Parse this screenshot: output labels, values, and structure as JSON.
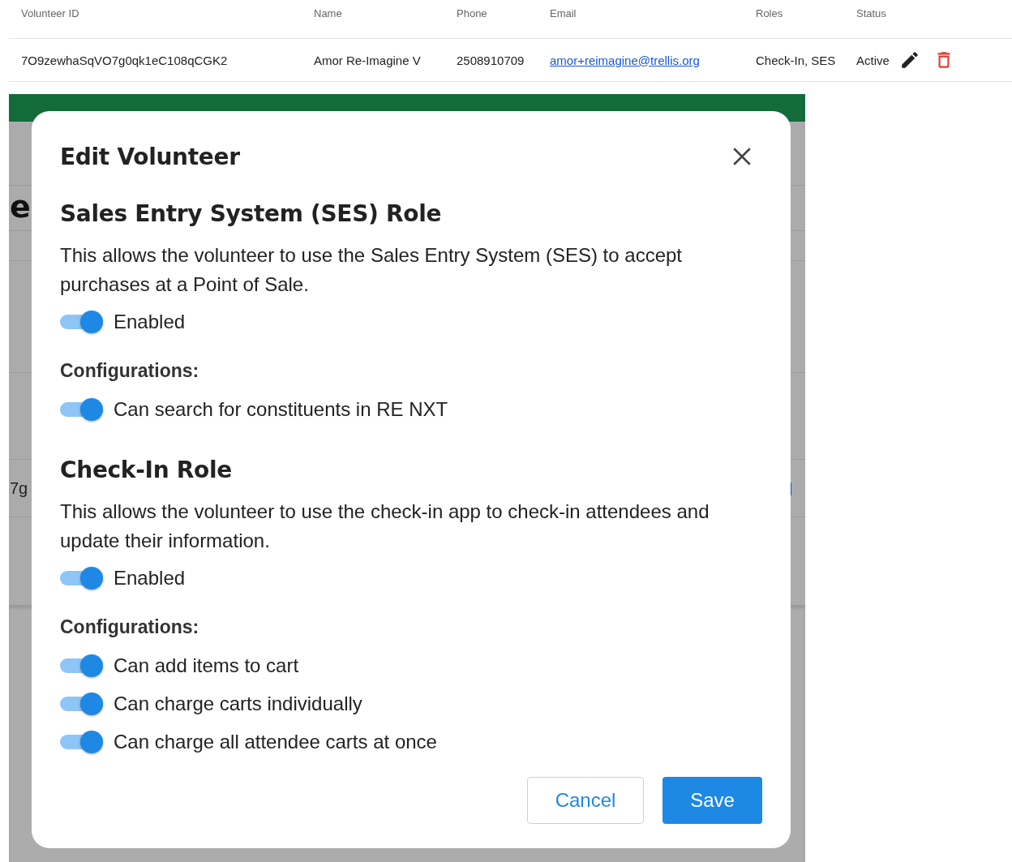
{
  "table": {
    "columns": [
      "Volunteer ID",
      "Name",
      "Phone",
      "Email",
      "Roles",
      "Status"
    ],
    "rows": [
      {
        "id": "7O9zewhaSqVO7g0qk1eC108qCGK2",
        "name": "Amor Re-Imagine V",
        "phone": "2508910709",
        "email": "amor+reimagine@trellis.org",
        "roles": "Check-In, SES",
        "status": "Active"
      }
    ]
  },
  "background": {
    "heading_fragment": "e",
    "cell_fragment": "7g"
  },
  "dialog": {
    "title": "Edit Volunteer",
    "sections": [
      {
        "title": "Sales Entry System (SES) Role",
        "description": "This allows the volunteer to use the Sales Entry System (SES) to accept purchases at a Point of Sale.",
        "toggle": {
          "label": "Enabled",
          "on": true
        },
        "config_title": "Configurations:",
        "configs": [
          {
            "label": "Can search for constituents in RE NXT",
            "on": true
          }
        ]
      },
      {
        "title": "Check-In Role",
        "description": "This allows the volunteer to use the check-in app to check-in attendees and update their information.",
        "toggle": {
          "label": "Enabled",
          "on": true
        },
        "config_title": "Configurations:",
        "configs": [
          {
            "label": "Can add items to cart",
            "on": true
          },
          {
            "label": "Can charge carts individually",
            "on": true
          },
          {
            "label": "Can charge all attendee carts at once",
            "on": true
          }
        ]
      }
    ],
    "buttons": [
      {
        "label": "Cancel",
        "kind": "secondary"
      },
      {
        "label": "Save",
        "kind": "primary"
      }
    ]
  }
}
